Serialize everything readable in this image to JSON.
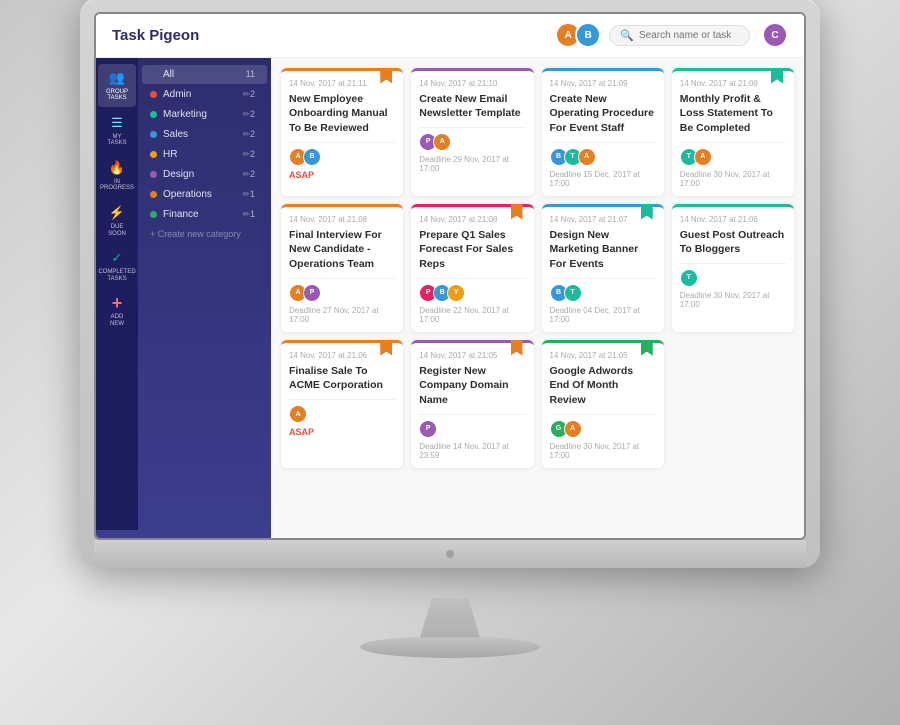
{
  "app": {
    "title": "Task Pigeon",
    "search_placeholder": "Search name or task"
  },
  "header": {
    "avatars": [
      {
        "id": "a",
        "color": "#e67e22",
        "label": "A"
      },
      {
        "id": "b",
        "color": "#3498db",
        "label": "B"
      },
      {
        "id": "c",
        "color": "#9b59b6",
        "label": "C"
      }
    ]
  },
  "sidebar": {
    "icons": [
      {
        "id": "group-tasks",
        "label": "GROUP TASKS",
        "icon": "👥",
        "active": true
      },
      {
        "id": "my-tasks",
        "label": "MY TASKS",
        "icon": "☰",
        "active": false
      },
      {
        "id": "in-progress",
        "label": "IN PROGRESS",
        "icon": "🔥",
        "active": false
      },
      {
        "id": "due-soon",
        "label": "DUE SOON",
        "icon": "⚡",
        "active": false
      },
      {
        "id": "completed-tasks",
        "label": "COMPLETED TASKS",
        "icon": "✓",
        "active": false
      },
      {
        "id": "add-new",
        "label": "ADD NEW",
        "icon": "+",
        "active": false
      }
    ],
    "categories": [
      {
        "id": "all",
        "label": "All",
        "count": 11,
        "color": "#fff",
        "dot": false
      },
      {
        "id": "admin",
        "label": "Admin",
        "count": 2,
        "color": "#e74c3c",
        "dot": true
      },
      {
        "id": "marketing",
        "label": "Marketing",
        "count": 2,
        "color": "#1abc9c",
        "dot": true
      },
      {
        "id": "sales",
        "label": "Sales",
        "count": 2,
        "color": "#3498db",
        "dot": true
      },
      {
        "id": "hr",
        "label": "HR",
        "count": 2,
        "color": "#f39c12",
        "dot": true
      },
      {
        "id": "design",
        "label": "Design",
        "count": 2,
        "color": "#9b59b6",
        "dot": true
      },
      {
        "id": "operations",
        "label": "Operations",
        "count": 1,
        "color": "#e67e22",
        "dot": true
      },
      {
        "id": "finance",
        "label": "Finance",
        "count": 1,
        "color": "#27ae60",
        "dot": true
      }
    ],
    "create_label": "+ Create new category"
  },
  "cards": [
    {
      "id": "card1",
      "timestamp": "14 Nov, 2017 at 21:11",
      "title": "New Employee Onboarding Manual To Be Reviewed",
      "color": "orange",
      "bookmark": "orange",
      "avatars": [
        {
          "color": "#e67e22"
        },
        {
          "color": "#3498db"
        }
      ],
      "deadline": "ASAP",
      "deadline_class": "asap"
    },
    {
      "id": "card2",
      "timestamp": "14 Nov, 2017 at 21:10",
      "title": "Create New Email Newsletter Template",
      "color": "purple",
      "bookmark": null,
      "avatars": [
        {
          "color": "#9b59b6"
        },
        {
          "color": "#e67e22"
        }
      ],
      "deadline": "Deadline 29 Nov, 2017 at 17:00",
      "deadline_class": ""
    },
    {
      "id": "card3",
      "timestamp": "14 Nov, 2017 at 21:09",
      "title": "Create New Operating Procedure For Event Staff",
      "color": "blue",
      "bookmark": null,
      "avatars": [
        {
          "color": "#3498db"
        },
        {
          "color": "#1abc9c"
        },
        {
          "color": "#e67e22"
        }
      ],
      "deadline": "Deadline 15 Dec, 2017 at 17:00",
      "deadline_class": ""
    },
    {
      "id": "card4",
      "timestamp": "14 Nov, 2017 at 21:09",
      "title": "Monthly Profit & Loss Statement To Be Completed",
      "color": "teal",
      "bookmark": "teal",
      "avatars": [
        {
          "color": "#1abc9c"
        },
        {
          "color": "#e67e22"
        }
      ],
      "deadline": "Deadline 30 Nov, 2017 at 17:00",
      "deadline_class": ""
    },
    {
      "id": "card5",
      "timestamp": "14 Nov, 2017 at 21:08",
      "title": "Final Interview For New Candidate - Operations Team",
      "color": "orange",
      "bookmark": null,
      "avatars": [
        {
          "color": "#e67e22"
        },
        {
          "color": "#9b59b6"
        }
      ],
      "deadline": "Deadline 27 Nov, 2017 at 17:00",
      "deadline_class": ""
    },
    {
      "id": "card6",
      "timestamp": "14 Nov, 2017 at 21:08",
      "title": "Prepare Q1 Sales Forecast For Sales Reps",
      "color": "pink",
      "bookmark": "orange",
      "avatars": [
        {
          "color": "#e91e63"
        },
        {
          "color": "#3498db"
        },
        {
          "color": "#f39c12"
        }
      ],
      "deadline": "Deadline 22 Nov, 2017 at 17:00",
      "deadline_class": ""
    },
    {
      "id": "card7",
      "timestamp": "14 Nov, 2017 at 21:07",
      "title": "Design New Marketing Banner For Events",
      "color": "blue",
      "bookmark": "teal",
      "avatars": [
        {
          "color": "#3498db"
        },
        {
          "color": "#1abc9c"
        }
      ],
      "deadline": "Deadline 04 Dec, 2017 at 17:00",
      "deadline_class": ""
    },
    {
      "id": "card8",
      "timestamp": "14 Nov, 2017 at 21:06",
      "title": "Guest Post Outreach To Bloggers",
      "color": "teal",
      "bookmark": null,
      "avatars": [
        {
          "color": "#1abc9c"
        }
      ],
      "deadline": "Deadline 30 Nov, 2017 at 17:00",
      "deadline_class": ""
    },
    {
      "id": "card9",
      "timestamp": "14 Nov, 2017 at 21:06",
      "title": "Finalise Sale To ACME Corporation",
      "color": "orange",
      "bookmark": "orange",
      "avatars": [
        {
          "color": "#e67e22"
        },
        {
          "color": "#3498db"
        }
      ],
      "deadline": "ASAP",
      "deadline_class": "asap"
    },
    {
      "id": "card10",
      "timestamp": "14 Nov, 2017 at 21:05",
      "title": "Register New Company Domain Name",
      "color": "purple",
      "bookmark": "orange",
      "avatars": [
        {
          "color": "#9b59b6"
        }
      ],
      "deadline": "Deadline 14 Nov, 2017 at 23:59",
      "deadline_class": ""
    },
    {
      "id": "card11",
      "timestamp": "14 Nov, 2017 at 21:05",
      "title": "Google Adwords End Of Month Review",
      "color": "green",
      "bookmark": "green",
      "avatars": [
        {
          "color": "#27ae60"
        },
        {
          "color": "#e67e22"
        }
      ],
      "deadline": "Deadline 30 Nov, 2017 at 17:00",
      "deadline_class": ""
    }
  ]
}
